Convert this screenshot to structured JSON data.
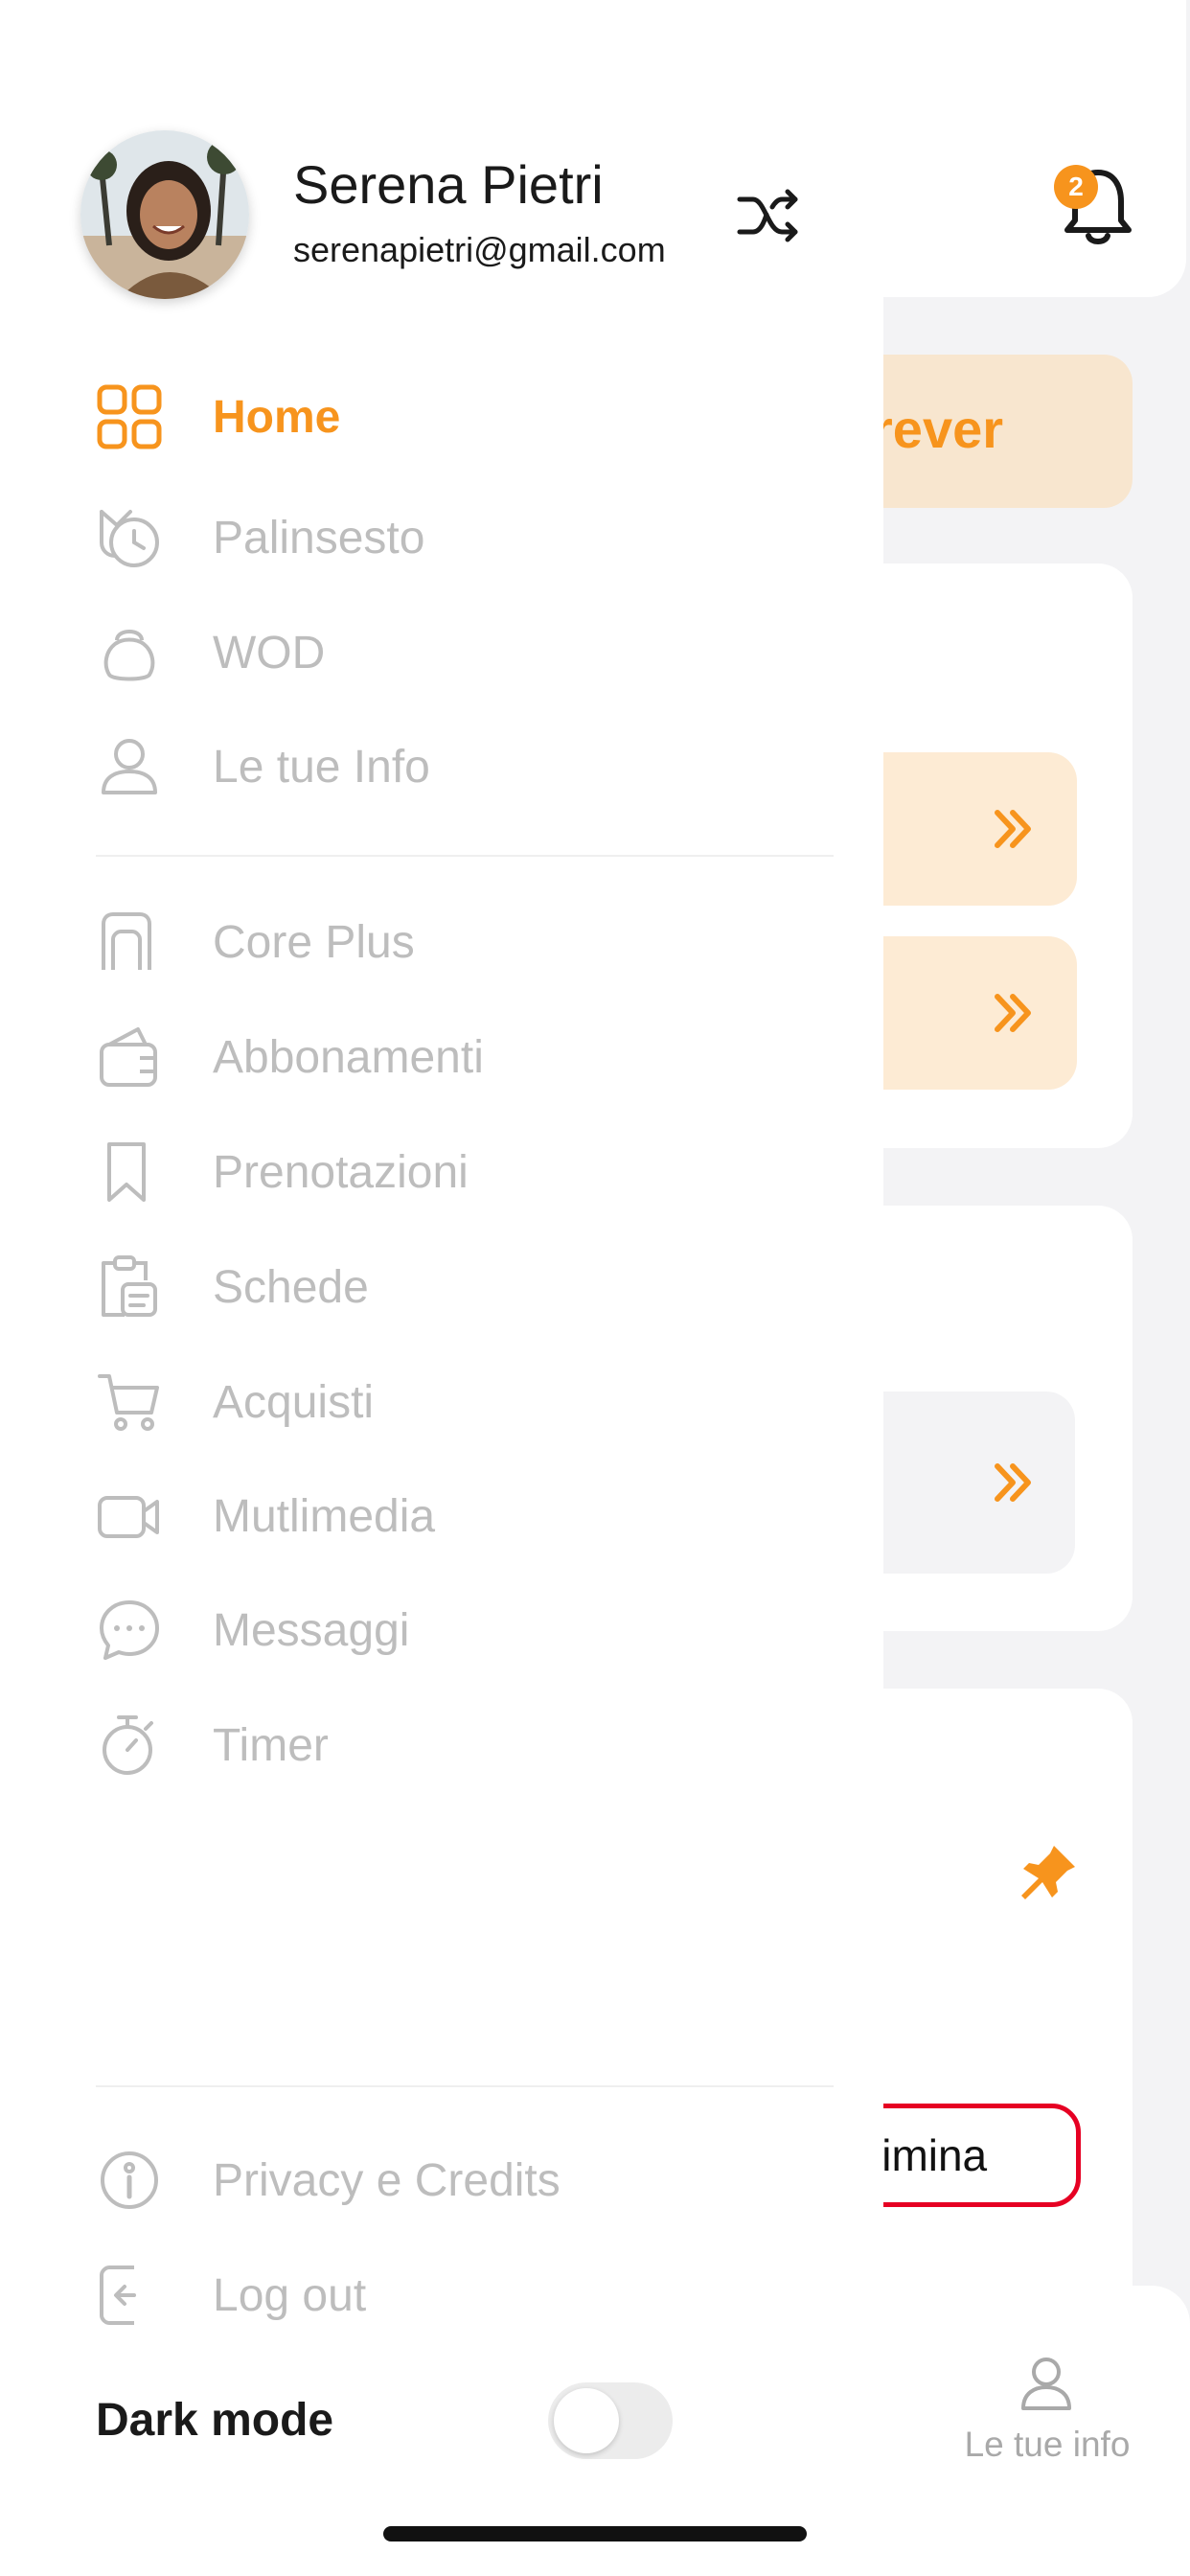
{
  "profile": {
    "name": "Serena Pietri",
    "email": "serenapietri@gmail.com"
  },
  "notifications": {
    "count": "2"
  },
  "menu_primary": [
    {
      "label": "Home",
      "icon": "grid-icon",
      "active": true
    },
    {
      "label": "Palinsesto",
      "icon": "schedule-history-icon",
      "active": false
    },
    {
      "label": "WOD",
      "icon": "kettlebell-icon",
      "active": false
    },
    {
      "label": "Le tue Info",
      "icon": "user-icon",
      "active": false
    }
  ],
  "menu_secondary": [
    {
      "label": "Core Plus",
      "icon": "door-icon"
    },
    {
      "label": "Abbonamenti",
      "icon": "wallet-icon"
    },
    {
      "label": "Prenotazioni",
      "icon": "bookmark-icon"
    },
    {
      "label": "Schede",
      "icon": "clipboard-icon"
    },
    {
      "label": "Acquisti",
      "icon": "cart-icon"
    },
    {
      "label": "Mutlimedia",
      "icon": "video-icon"
    },
    {
      "label": "Messaggi",
      "icon": "chat-icon"
    },
    {
      "label": "Timer",
      "icon": "stopwatch-icon"
    }
  ],
  "menu_footer": [
    {
      "label": "Privacy e Credits",
      "icon": "info-icon"
    },
    {
      "label": "Log out",
      "icon": "logout-icon"
    }
  ],
  "dark_mode": {
    "label": "Dark mode",
    "enabled": false
  },
  "background": {
    "promo_text": "rever",
    "elimina_text": "limina",
    "tab_info_label": "Le tue info"
  },
  "colors": {
    "accent": "#f7941d",
    "inactive": "#bdbdbd",
    "danger": "#e60023"
  }
}
